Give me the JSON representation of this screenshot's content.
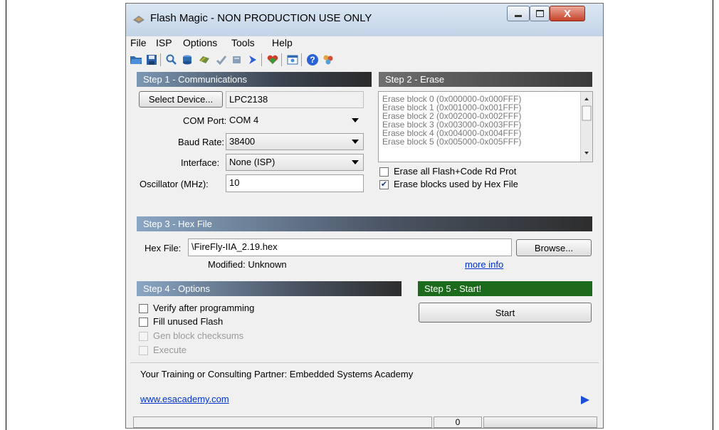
{
  "window": {
    "title": "Flash Magic - NON PRODUCTION USE ONLY",
    "close_glyph": "X"
  },
  "menu": [
    "File",
    "ISP",
    "Options",
    "Tools",
    "Help"
  ],
  "toolbar_icons": [
    "open-folder-icon",
    "save-icon",
    "search-icon",
    "chip-icon",
    "program-icon",
    "verify-check-icon",
    "erase-icon",
    "play-arrow-icon",
    "heart-icon",
    "window-icon",
    "help-icon",
    "people-icon"
  ],
  "step1": {
    "header": "Step 1 - Communications",
    "select_device_label": "Select Device...",
    "device_value": "LPC2138",
    "com_port_label": "COM Port:",
    "com_port_value": "COM 4",
    "baud_rate_label": "Baud Rate:",
    "baud_rate_value": "38400",
    "interface_label": "Interface:",
    "interface_value": "None (ISP)",
    "oscillator_label": "Oscillator (MHz):",
    "oscillator_value": "10"
  },
  "step2": {
    "header": "Step 2 - Erase",
    "blocks": [
      "Erase block 0 (0x000000-0x000FFF)",
      "Erase block 1 (0x001000-0x001FFF)",
      "Erase block 2 (0x002000-0x002FFF)",
      "Erase block 3 (0x003000-0x003FFF)",
      "Erase block 4 (0x004000-0x004FFF)",
      "Erase block 5 (0x005000-0x005FFF)"
    ],
    "erase_all_label": "Erase all Flash+Code Rd Prot",
    "erase_all_checked": false,
    "erase_used_label": "Erase blocks used by Hex File",
    "erase_used_checked": true
  },
  "step3": {
    "header": "Step 3 - Hex File",
    "hex_file_label": "Hex File:",
    "hex_file_value": "\\FireFly-IIA_2.19.hex",
    "browse_label": "Browse...",
    "modified_text": "Modified: Unknown",
    "more_info_label": "more info"
  },
  "step4": {
    "header": "Step 4 - Options",
    "verify_label": "Verify after programming",
    "fill_unused_label": "Fill unused Flash",
    "gen_checksums_label": "Gen block checksums",
    "execute_label": "Execute"
  },
  "step5": {
    "header": "Step 5 - Start!",
    "start_label": "Start"
  },
  "footer": {
    "partner_text": "Your Training or Consulting Partner: Embedded Systems Academy",
    "website_link": "www.esacademy.com",
    "status_count": "0"
  },
  "colors": {
    "step5_green": "#1c6b1c",
    "link_blue": "#0033cc"
  }
}
